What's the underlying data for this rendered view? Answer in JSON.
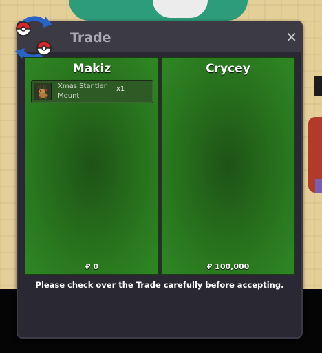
{
  "window": {
    "title": "Trade",
    "close_label": "✕"
  },
  "left_panel": {
    "player_name": "Makiz",
    "items": [
      {
        "name": "Xmas Stantler Mount",
        "quantity": "x1",
        "icon": "stantler-icon"
      }
    ],
    "money": "₽ 0"
  },
  "right_panel": {
    "player_name": "Crycey",
    "items": [],
    "money": "₽ 100,000"
  },
  "footer": {
    "message": "Please check over the Trade carefully before accepting."
  },
  "colors": {
    "panel_green": "#2a7a1f",
    "window_bg": "#2a2832",
    "titlebar_bg": "#3c3b44"
  }
}
